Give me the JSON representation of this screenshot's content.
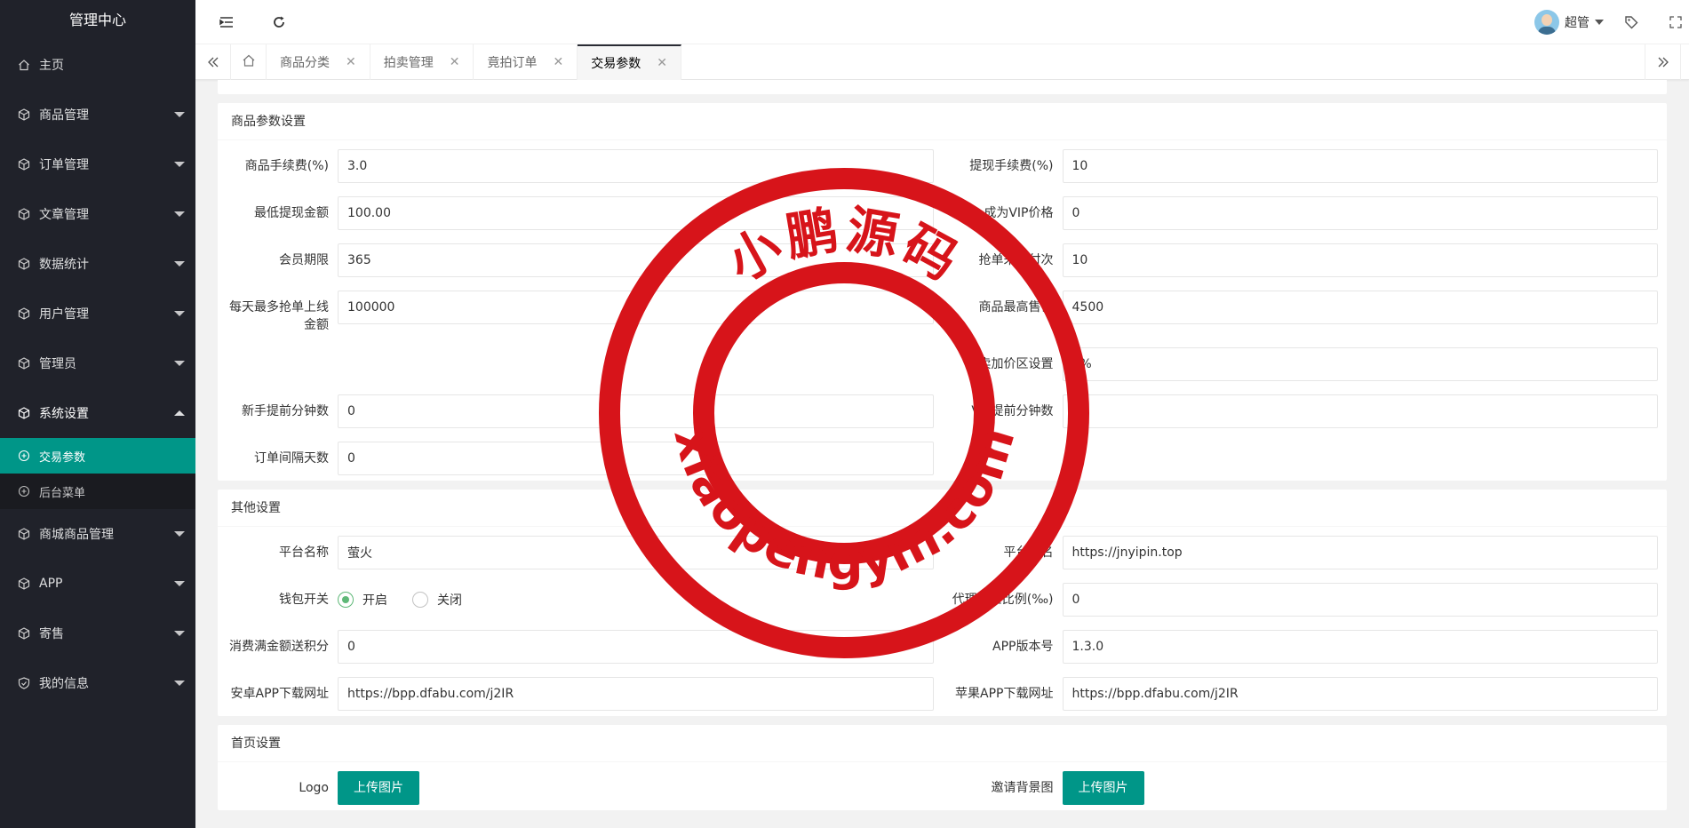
{
  "sidebar": {
    "title": "管理中心",
    "items": [
      {
        "label": "主页",
        "icon": "home-icon"
      },
      {
        "label": "商品管理",
        "icon": "cube-icon"
      },
      {
        "label": "订单管理",
        "icon": "cube-icon"
      },
      {
        "label": "文章管理",
        "icon": "cube-icon"
      },
      {
        "label": "数据统计",
        "icon": "cube-icon"
      },
      {
        "label": "用户管理",
        "icon": "cube-icon"
      },
      {
        "label": "管理员",
        "icon": "cube-icon"
      },
      {
        "label": "系统设置",
        "icon": "cube-icon"
      }
    ],
    "sub_items": [
      {
        "label": "交易参数",
        "icon": "plus-circle-icon"
      },
      {
        "label": "后台菜单",
        "icon": "plus-circle-icon"
      }
    ],
    "items_after": [
      {
        "label": "商城商品管理",
        "icon": "cube-icon"
      },
      {
        "label": "APP",
        "icon": "cube-icon"
      },
      {
        "label": "寄售",
        "icon": "cube-icon"
      },
      {
        "label": "我的信息",
        "icon": "cube-icon"
      }
    ]
  },
  "header": {
    "user_name": "超管",
    "icons": [
      "menu-fold-icon",
      "refresh-icon",
      "tag-icon",
      "fullscreen-icon"
    ]
  },
  "tabs": [
    {
      "label": "商品分类"
    },
    {
      "label": "拍卖管理"
    },
    {
      "label": "竟拍订单"
    },
    {
      "label": "交易参数"
    }
  ],
  "sections": {
    "goods": {
      "title": "商品参数设置",
      "left": [
        {
          "label": "商品手续费(%)",
          "value": "3.0"
        },
        {
          "label": "最低提现金额",
          "value": "100.00"
        },
        {
          "label": "会员期限",
          "value": "365"
        },
        {
          "label": "每天最多抢单上线金额",
          "value": "100000"
        },
        {
          "label": "",
          "value": ""
        },
        {
          "label": "新手提前分钟数",
          "value": "0"
        },
        {
          "label": "订单间隔天数",
          "value": "0"
        }
      ],
      "right": [
        {
          "label": "提现手续费(%)",
          "value": "10"
        },
        {
          "label": "成为VIP价格",
          "value": "0"
        },
        {
          "label": "抢单未支付次",
          "value": "10"
        },
        {
          "label": "商品最高售价",
          "value": "4500"
        },
        {
          "label": "拍卖加价区设置",
          "value": "5%"
        },
        {
          "label": "VIP提前分钟数",
          "value": "0"
        }
      ]
    },
    "other": {
      "title": "其他设置",
      "platform_name": {
        "label": "平台名称",
        "value": "萤火"
      },
      "domain": {
        "label": "平台域名",
        "value": "https://jnyipin.top"
      },
      "wallet": {
        "label": "钱包开关",
        "on": "开启",
        "off": "关闭"
      },
      "commission": {
        "label": "代理佣金比例(‰)",
        "value": "0"
      },
      "points": {
        "label": "消费满金额送积分",
        "value": "0"
      },
      "app_version": {
        "label": "APP版本号",
        "value": "1.3.0"
      },
      "android_url": {
        "label": "安卓APP下载网址",
        "value": "https://bpp.dfabu.com/j2IR"
      },
      "ios_url": {
        "label": "苹果APP下载网址",
        "value": "https://bpp.dfabu.com/j2IR"
      }
    },
    "home": {
      "title": "首页设置",
      "logo": {
        "label": "Logo",
        "button": "上传图片"
      },
      "invite_bg": {
        "label": "邀请背景图",
        "button": "上传图片"
      }
    }
  },
  "stamp": {
    "top_text": "小鹏源码",
    "bottom_text": "xiaopengym.com",
    "color": "#d7141a"
  }
}
